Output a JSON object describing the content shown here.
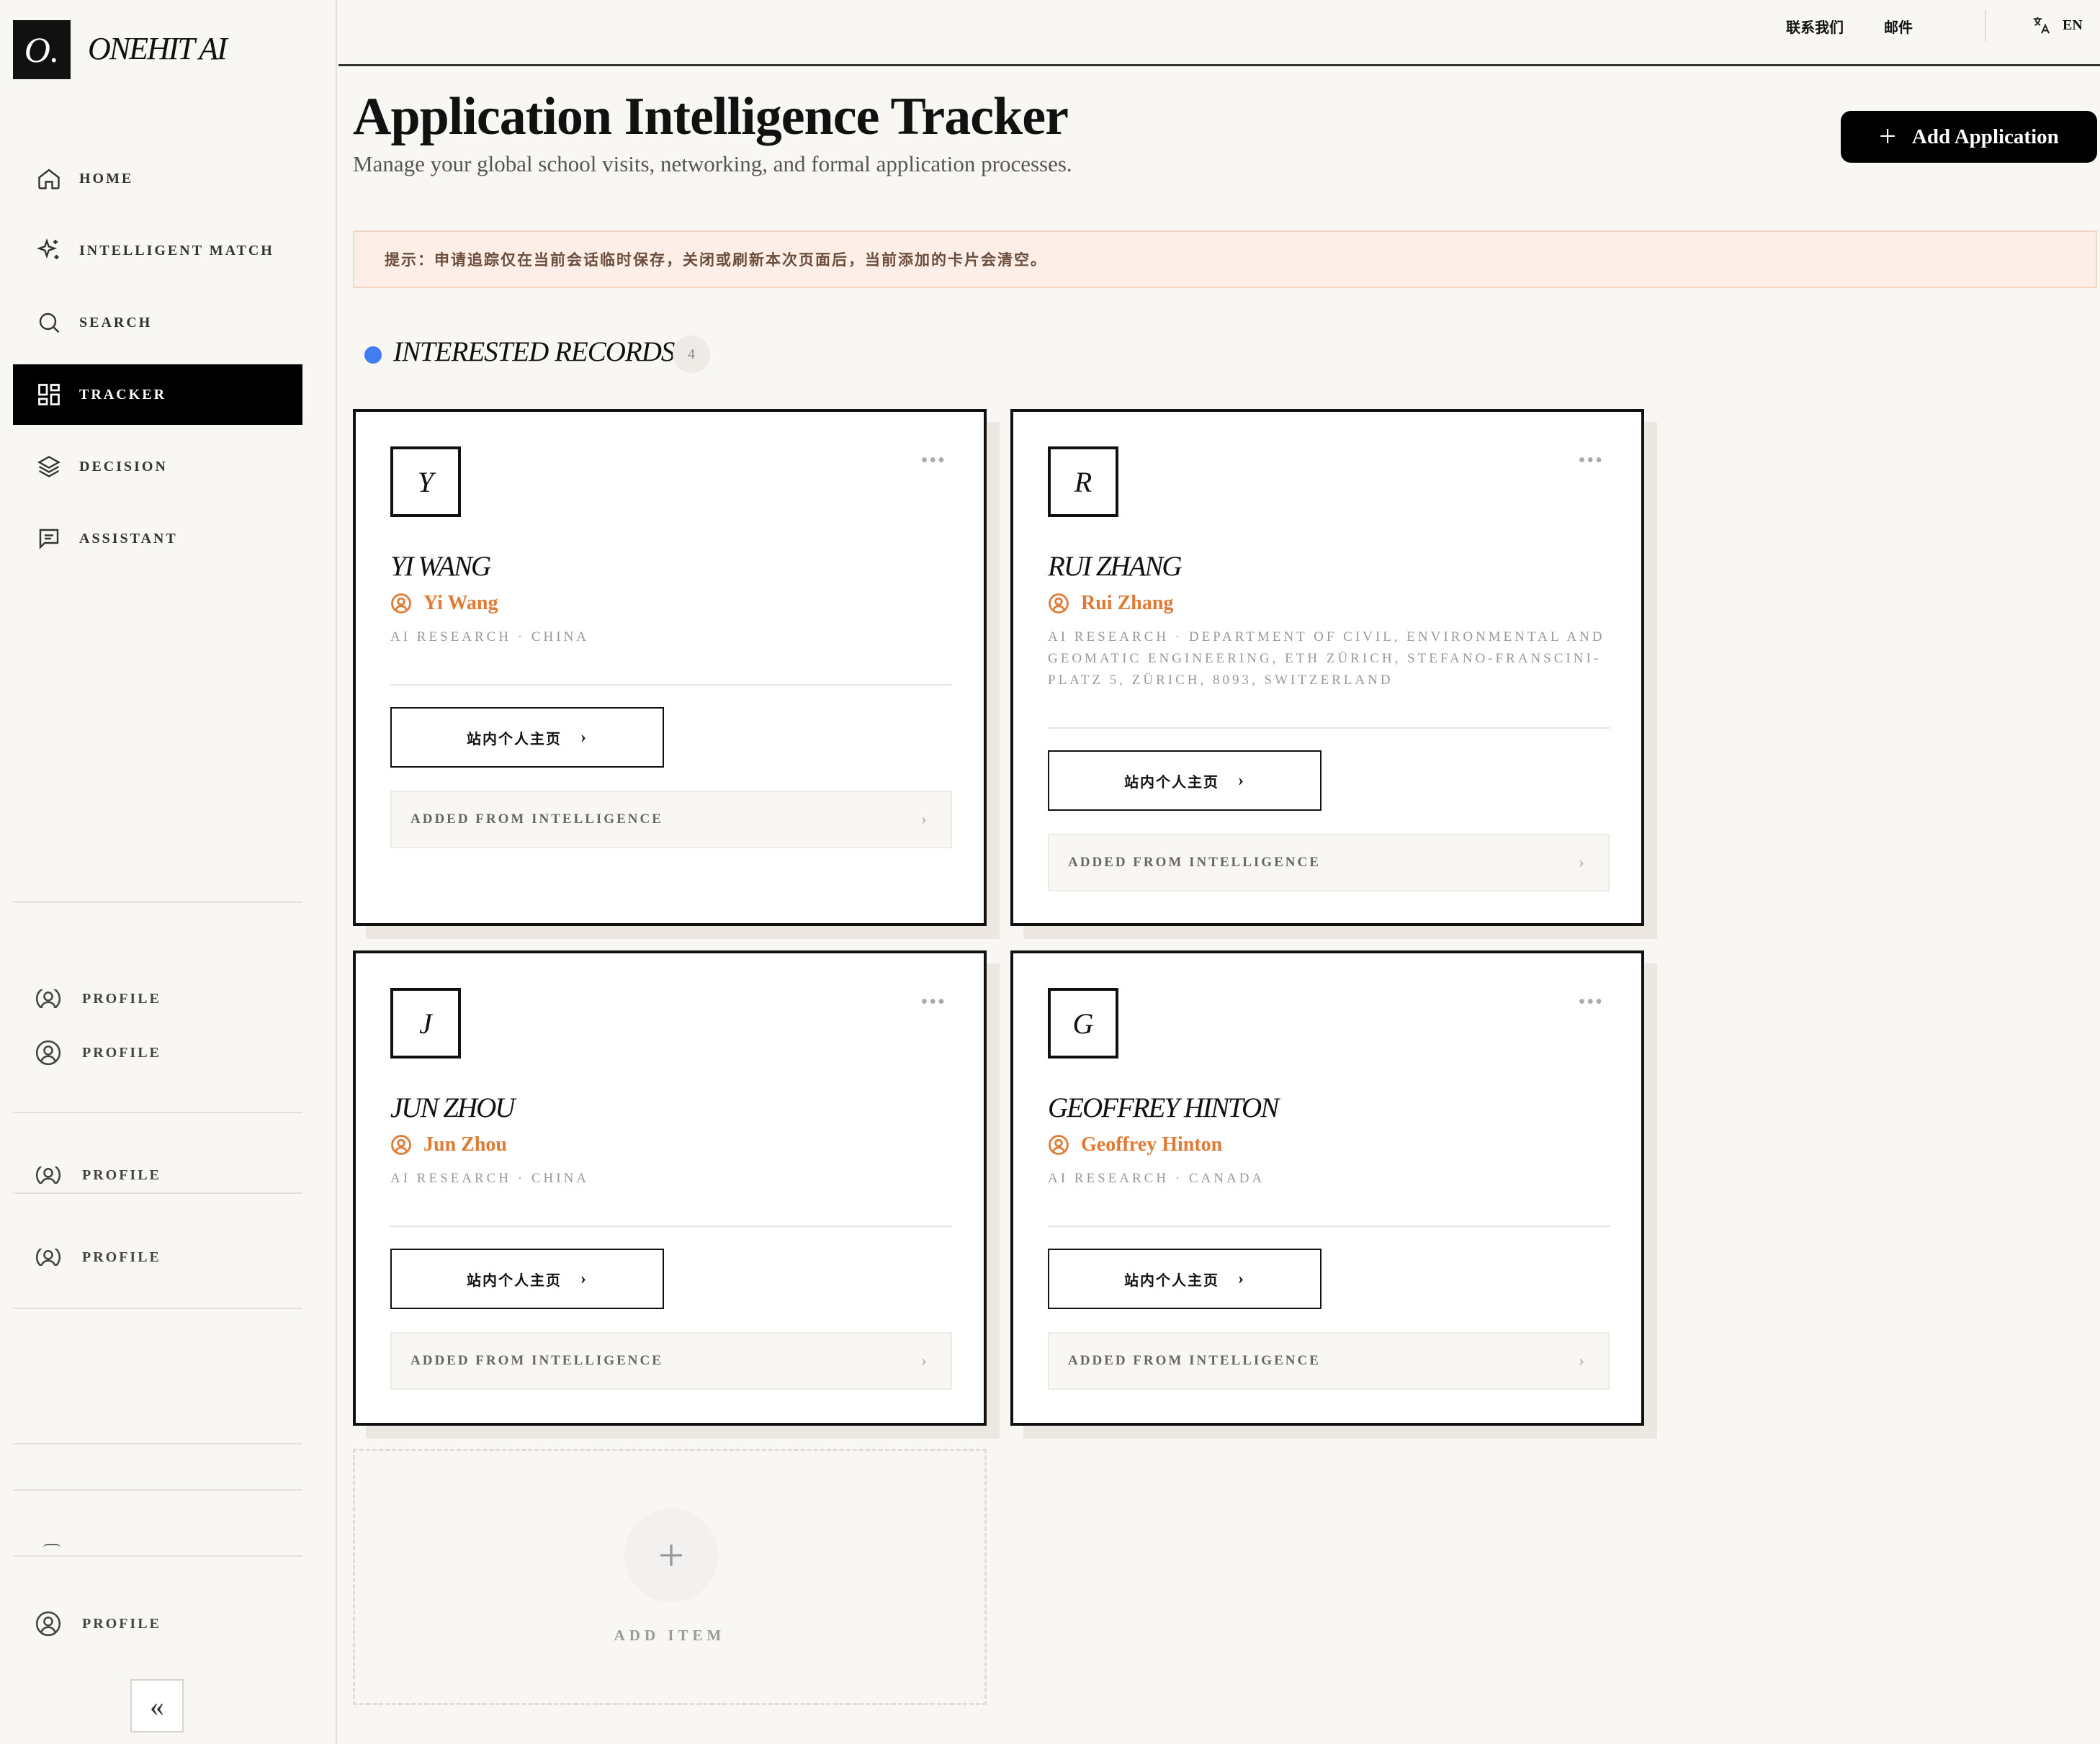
{
  "brand": {
    "logo_mark": "O.",
    "name": "ONEHIT AI"
  },
  "sidebar": {
    "nav": [
      {
        "label": "HOME",
        "icon": "home-icon"
      },
      {
        "label": "INTELLIGENT MATCH",
        "icon": "sparkle-icon"
      },
      {
        "label": "SEARCH",
        "icon": "search-icon"
      },
      {
        "label": "TRACKER",
        "icon": "dashboard-icon",
        "active": true
      },
      {
        "label": "DECISION",
        "icon": "layers-icon"
      },
      {
        "label": "ASSISTANT",
        "icon": "chat-icon"
      }
    ],
    "profile_label": "PROFILE",
    "collapse_glyph": "«"
  },
  "topbar": {
    "contact": "联系我们",
    "mail": "邮件",
    "lang": "EN"
  },
  "header": {
    "title": "Application Intelligence Tracker",
    "subtitle": "Manage your global school visits, networking, and formal application processes.",
    "add_button": "Add Application"
  },
  "notice": "提示：申请追踪仅在当前会话临时保存，关闭或刷新本次页面后，当前添加的卡片会清空。",
  "section": {
    "title": "INTERESTED RECORDS",
    "count": "4"
  },
  "cards": [
    {
      "initial": "Y",
      "name": "YI WANG",
      "person": "Yi Wang",
      "meta": "AI RESEARCH · CHINA",
      "button": "站内个人主页",
      "footer": "ADDED FROM INTELLIGENCE"
    },
    {
      "initial": "R",
      "name": "RUI ZHANG",
      "person": "Rui Zhang",
      "meta": "AI RESEARCH · DEPARTMENT OF CIVIL, ENVIRONMENTAL AND GEOMATIC ENGINEERING, ETH ZÜRICH, STEFANO-FRANSCINI-PLATZ 5, ZÜRICH, 8093, SWITZERLAND",
      "button": "站内个人主页",
      "footer": "ADDED FROM INTELLIGENCE"
    },
    {
      "initial": "J",
      "name": "JUN ZHOU",
      "person": "Jun Zhou",
      "meta": "AI RESEARCH · CHINA",
      "button": "站内个人主页",
      "footer": "ADDED FROM INTELLIGENCE"
    },
    {
      "initial": "G",
      "name": "GEOFFREY HINTON",
      "person": "Geoffrey Hinton",
      "meta": "AI RESEARCH · CANADA",
      "button": "站内个人主页",
      "footer": "ADDED FROM INTELLIGENCE"
    }
  ],
  "add_item": "ADD ITEM",
  "colors": {
    "accent_orange": "#e07a35",
    "accent_blue": "#3f7df0",
    "notice_bg": "#fdefe7"
  }
}
